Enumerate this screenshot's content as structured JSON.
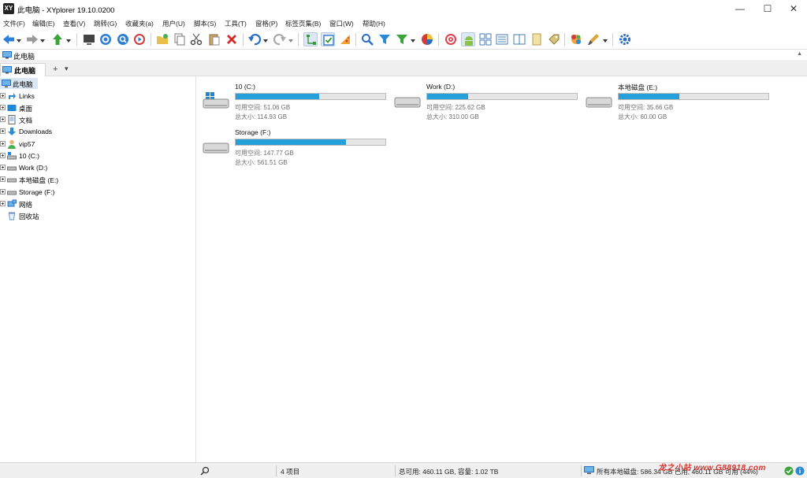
{
  "window": {
    "title": "此电脑 - XYplorer 19.10.0200",
    "app_icon_text": "XY",
    "minimize": "—",
    "maximize": "☐",
    "close": "✕"
  },
  "menu": [
    "文件(F)",
    "编辑(E)",
    "查看(V)",
    "跳转(G)",
    "收藏夹(a)",
    "用户(U)",
    "脚本(S)",
    "工具(T)",
    "窗格(P)",
    "标签页集(B)",
    "窗口(W)",
    "帮助(H)"
  ],
  "address": {
    "path": "此电脑",
    "scroll_glyph": "▲"
  },
  "tabs": {
    "active_label": "此电脑",
    "add_glyph": "+",
    "list_glyph": "▾"
  },
  "tree": {
    "root": "此电脑",
    "items": [
      "Links",
      "桌面",
      "文档",
      "Downloads",
      "vip57",
      "10 (C:)",
      "Work (D:)",
      "本地磁盘 (E:)",
      "Storage (F:)",
      "网络",
      "回收站"
    ]
  },
  "drives": [
    {
      "name": "10 (C:)",
      "used_fraction": 0.556,
      "free": "可用空间: 51.06 GB",
      "total": "总大小: 114.93 GB",
      "system": true
    },
    {
      "name": "Work (D:)",
      "used_fraction": 0.273,
      "free": "可用空间: 225.62 GB",
      "total": "总大小: 310.00 GB",
      "system": false
    },
    {
      "name": "本地磁盘 (E:)",
      "used_fraction": 0.406,
      "free": "可用空间: 35.66 GB",
      "total": "总大小: 60.00 GB",
      "system": false
    },
    {
      "name": "Storage (F:)",
      "used_fraction": 0.737,
      "free": "可用空间: 147.77 GB",
      "total": "总大小: 561.51 GB",
      "system": false
    }
  ],
  "status": {
    "count": "4 项目",
    "summary": "总可用: 460.11 GB, 容量: 1.02 TB",
    "disks": "所有本地磁盘: 586.34 GB 已用, 460.11 GB 可用 (44%)"
  },
  "watermark": "龙之小站 www.G88918.com",
  "colors": {
    "bar_fill": "#26a0da",
    "bar_track": "#e6e6e6",
    "tree_selected": "#d9e6f3"
  }
}
